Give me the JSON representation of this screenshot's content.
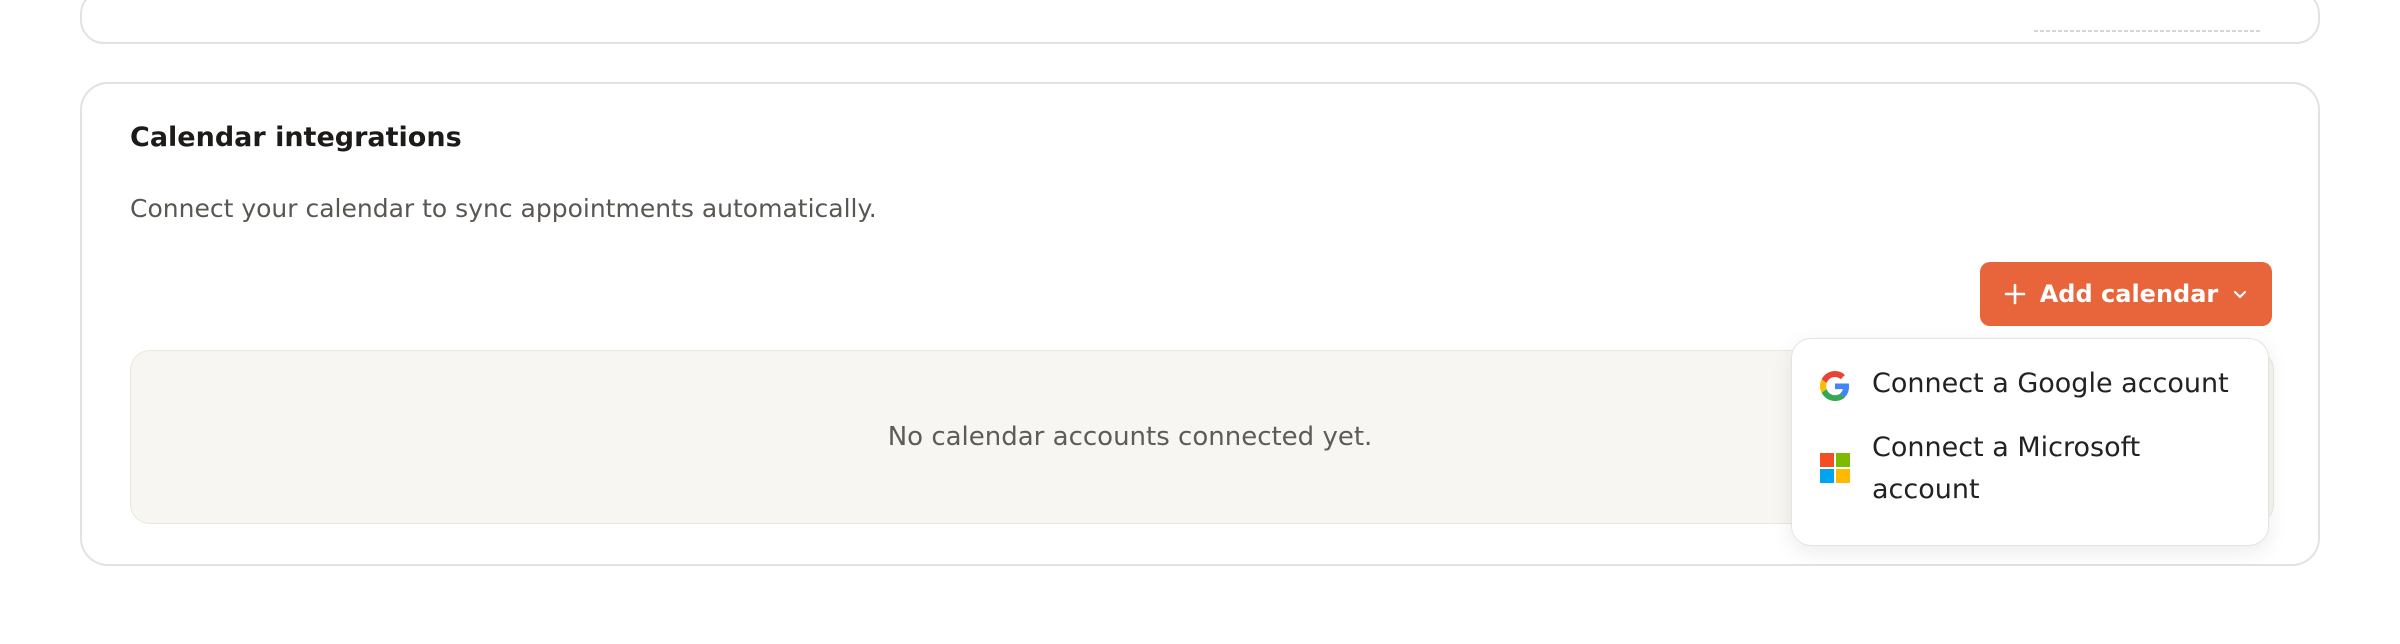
{
  "calendar_integrations": {
    "title": "Calendar integrations",
    "description": "Connect your calendar to sync appointments automatically.",
    "add_button_label": "Add calendar",
    "empty_state": "No calendar accounts connected yet."
  },
  "dropdown": {
    "items": [
      {
        "label": "Connect a Google account",
        "icon": "google-icon"
      },
      {
        "label": "Connect a Microsoft account",
        "icon": "microsoft-icon"
      }
    ]
  },
  "colors": {
    "accent": "#e8643a",
    "empty_bg": "#f8f6f2",
    "border": "#e4e2df"
  }
}
